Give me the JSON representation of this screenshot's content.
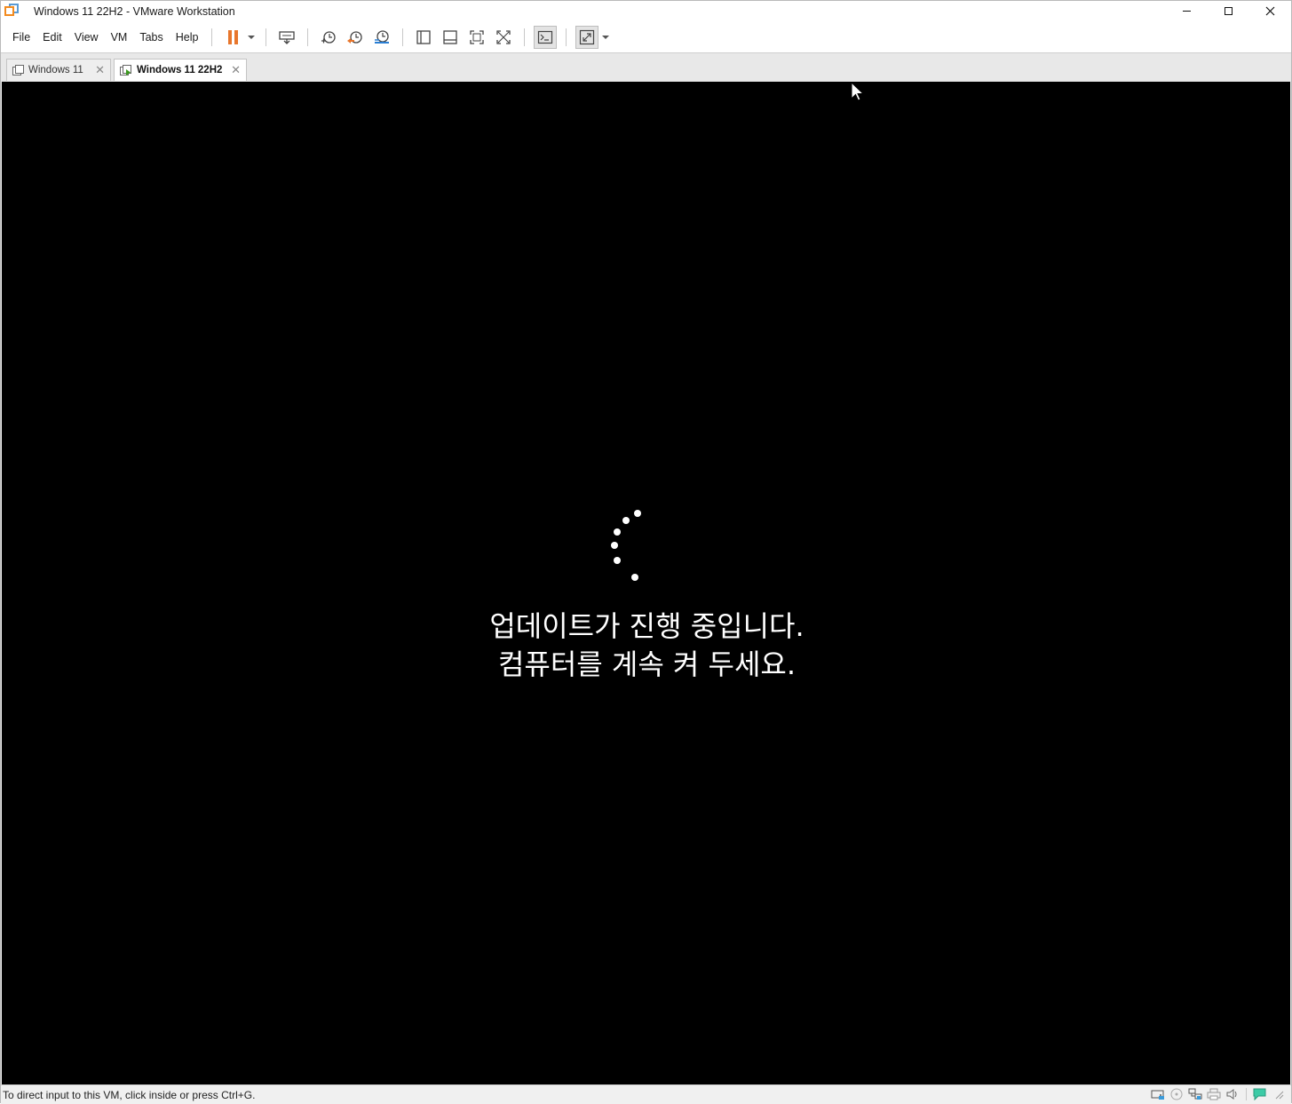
{
  "window": {
    "title": "Windows 11 22H2 - VMware Workstation"
  },
  "menu": {
    "items": [
      "File",
      "Edit",
      "View",
      "VM",
      "Tabs",
      "Help"
    ]
  },
  "toolbar": {
    "buttons": [
      "pause-icon",
      "send-ctrl-alt-del-icon",
      "snapshot-icon",
      "revert-snapshot-icon",
      "snapshot-manager-icon",
      "library-icon",
      "thumbnail-bar-icon",
      "full-screen-icon",
      "unity-icon",
      "console-icon",
      "stretch-guest-icon"
    ]
  },
  "tabs": [
    {
      "label": "Windows 11",
      "active": false
    },
    {
      "label": "Windows 11 22H2",
      "active": true
    }
  ],
  "vm": {
    "line1": "업데이트가 진행 중입니다.",
    "line2": "컴퓨터를 계속 켜 두세요."
  },
  "status": {
    "text": "To direct input to this VM, click inside or press Ctrl+G.",
    "icons": [
      "hard-disk-icon",
      "cd-dvd-icon",
      "network-icon",
      "printer-icon",
      "sound-icon",
      "message-icon"
    ]
  }
}
